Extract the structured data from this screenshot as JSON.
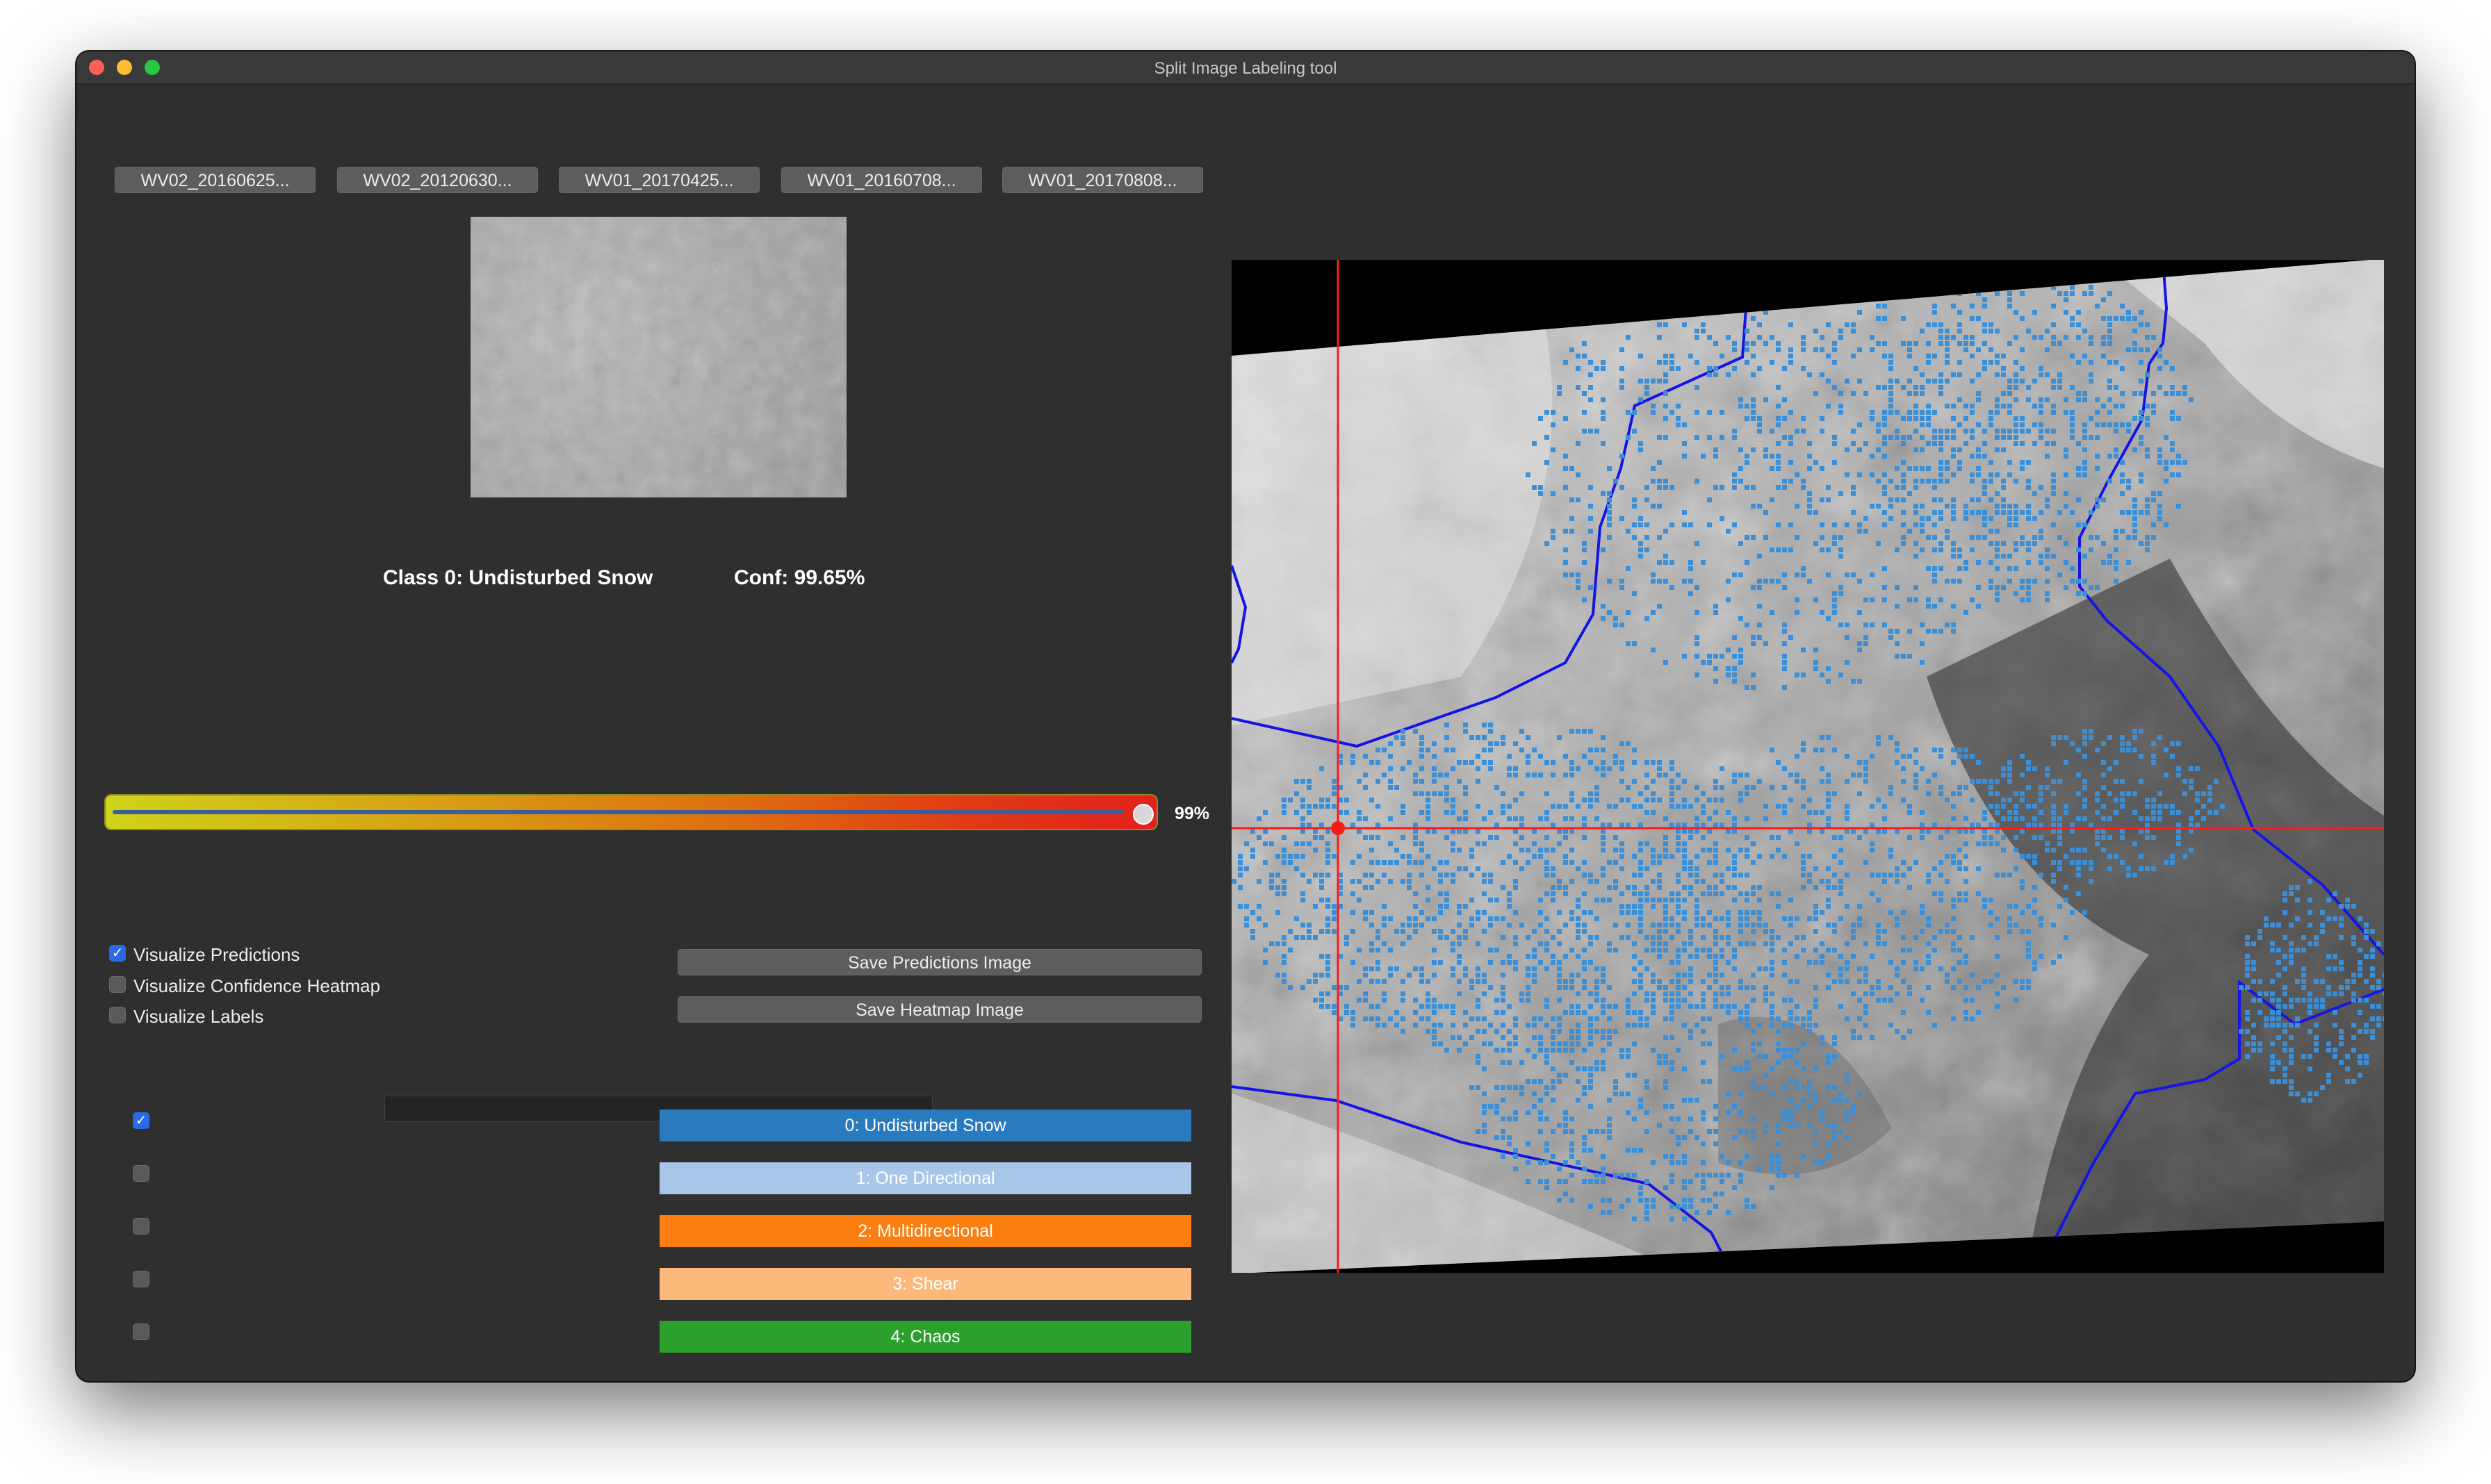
{
  "window": {
    "title": "Split Image Labeling tool"
  },
  "tabs": [
    {
      "label": "WV02_20160625..."
    },
    {
      "label": "WV02_20120630..."
    },
    {
      "label": "WV01_20170425..."
    },
    {
      "label": "WV01_20160708..."
    },
    {
      "label": "WV01_20170808..."
    }
  ],
  "prediction": {
    "class_text": "Class 0: Undisturbed Snow",
    "conf_text": "Conf: 99.65%"
  },
  "threshold": {
    "value": 0.99,
    "label": "99%"
  },
  "options": [
    {
      "label": "Visualize Predictions",
      "checked": true
    },
    {
      "label": "Visualize Confidence Heatmap",
      "checked": false
    },
    {
      "label": "Visualize Labels",
      "checked": false
    }
  ],
  "actions": {
    "save_predictions": "Save Predictions Image",
    "save_heatmap": "Save Heatmap Image"
  },
  "classes": [
    {
      "label": "0: Undisturbed Snow",
      "color": "#2a7ac0",
      "text_color": "#ffffff",
      "checked": true
    },
    {
      "label": "1: One Directional",
      "color": "#a8c6e8",
      "text_color": "#ffffff",
      "checked": false
    },
    {
      "label": "2: Multidirectional",
      "color": "#fb7f10",
      "text_color": "#ffffff",
      "checked": false
    },
    {
      "label": "3: Shear",
      "color": "#fdb97b",
      "text_color": "#ffffff",
      "checked": false
    },
    {
      "label": "4: Chaos",
      "color": "#2ca02c",
      "text_color": "#ffffff",
      "checked": false
    }
  ],
  "colors": {
    "prediction_marks": "#3a8fd6",
    "boundary": "#1414e6",
    "crosshair": "#ff1a1a"
  }
}
